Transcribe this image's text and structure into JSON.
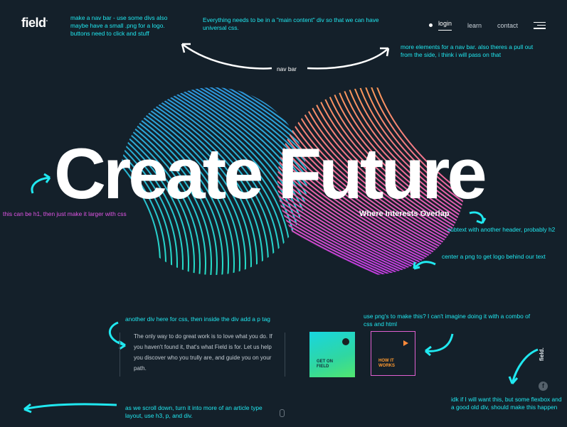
{
  "logo": {
    "text": "field",
    "dot": "."
  },
  "nav": {
    "login": "login",
    "learn": "learn",
    "contact": "contact"
  },
  "hero": {
    "title": "Create Future",
    "subtitle": "Where Interests Overlap"
  },
  "intro": "The only way to do great work is to love what you do. If you haven't found it, that's what Field is for. Let us help you discover who you trully are, and guide you on your path.",
  "cards": {
    "get_on_field": {
      "line1": "GET ON",
      "line2": "FIELD"
    },
    "how_it_works": {
      "line1": "HOW IT",
      "line2": "WORKS"
    }
  },
  "side": {
    "vertical_logo": "field.",
    "facebook_glyph": "f"
  },
  "annotations": {
    "navbar_left": "make a nav bar - use some divs also maybe have a small .png for a logo. buttons need to click and stuff",
    "main_content": "Everything needs to be in a \"main content\" div so that we can have universal css.",
    "navbar_right": "more elements for a nav bar. also theres a pull out from the side, i think i will pass on that",
    "nav_bar": "nav bar",
    "h1_note": "this can be h1, then just make it larger with css",
    "h2_note": "subtext with another header, probably h2",
    "logo_note": "center a png to get logo behind our text",
    "div_note": "another div here for css, then inside the div add a p tag",
    "png_note": "use png's to make this? I can't imagine doing it with a combo of css and html",
    "flexbox_note": "idk if I will want this, but some flexbox and a good old div, should make this happen",
    "scroll_note": "as we scroll down, turn it into more of an article type layout, use h3, p, and div."
  },
  "colors": {
    "background": "#14202a",
    "annotation": "#20e8f0",
    "annotation_h1": "#e255e6",
    "left_circle": [
      "#2e9fe0",
      "#28e0c8"
    ],
    "right_circle": [
      "#ff9a4a",
      "#e040d8"
    ]
  }
}
